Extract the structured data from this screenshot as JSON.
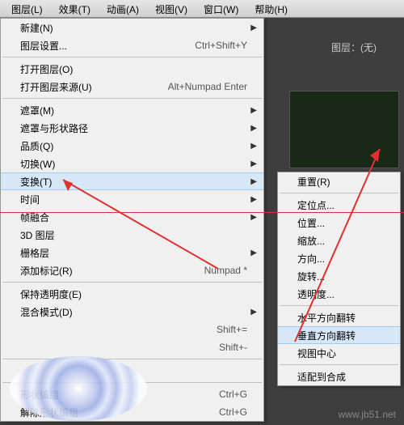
{
  "menubar": [
    {
      "label": "图层(L)"
    },
    {
      "label": "效果(T)"
    },
    {
      "label": "动画(A)"
    },
    {
      "label": "视图(V)"
    },
    {
      "label": "窗口(W)"
    },
    {
      "label": "帮助(H)"
    }
  ],
  "panel_title": "图层：(无)",
  "menu1": {
    "groups": [
      [
        {
          "label": "新建(N)",
          "submenu": true
        },
        {
          "label": "图层设置...",
          "shortcut": "Ctrl+Shift+Y"
        }
      ],
      [
        {
          "label": "打开图层(O)"
        },
        {
          "label": "打开图层来源(U)",
          "shortcut": "Alt+Numpad Enter"
        }
      ],
      [
        {
          "label": "遮罩(M)",
          "submenu": true
        },
        {
          "label": "遮罩与形状路径",
          "submenu": true
        },
        {
          "label": "品质(Q)",
          "submenu": true
        },
        {
          "label": "切换(W)",
          "submenu": true
        },
        {
          "label": "变换(T)",
          "submenu": true,
          "hover": true
        },
        {
          "label": "时间",
          "submenu": true
        },
        {
          "label": "帧融合",
          "submenu": true
        },
        {
          "label": "3D 图层"
        },
        {
          "label": "栅格层",
          "submenu": true
        },
        {
          "label": "添加标记(R)",
          "shortcut": "Numpad *"
        }
      ],
      [
        {
          "label": "保持透明度(E)"
        },
        {
          "label": "混合模式(D)",
          "submenu": true
        },
        {
          "label": "",
          "shortcut": "Shift+="
        },
        {
          "label": "",
          "shortcut": "Shift+-"
        }
      ],
      [
        {
          "label": ""
        }
      ],
      [
        {
          "label": "形状编组",
          "shortcut": "Ctrl+G"
        },
        {
          "label": "解除形状编组",
          "shortcut": "Ctrl+G"
        }
      ]
    ]
  },
  "menu2": {
    "groups": [
      [
        {
          "label": "重置(R)"
        }
      ],
      [
        {
          "label": "定位点..."
        },
        {
          "label": "位置..."
        },
        {
          "label": "缩放..."
        },
        {
          "label": "方向..."
        },
        {
          "label": "旋转..."
        },
        {
          "label": "透明度..."
        }
      ],
      [
        {
          "label": "水平方向翻转"
        },
        {
          "label": "垂直方向翻转",
          "hover": true
        },
        {
          "label": "视图中心"
        }
      ],
      [
        {
          "label": "适配到合成"
        }
      ]
    ]
  },
  "watermark": "www.jb51.net"
}
